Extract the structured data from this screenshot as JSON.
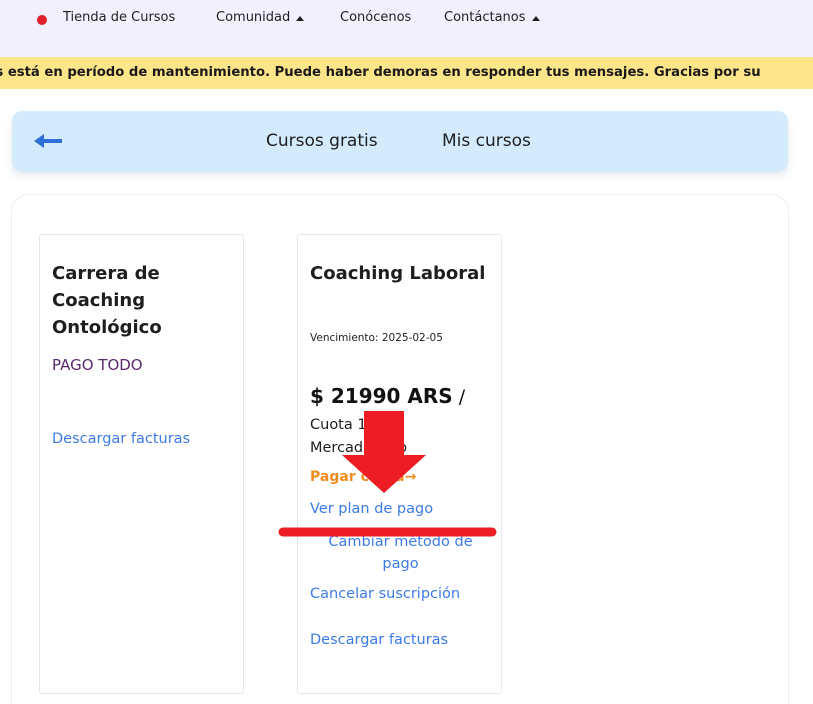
{
  "nav": {
    "store": "Tienda de Cursos",
    "community": "Comunidad",
    "about": "Conócenos",
    "contact": "Contáctanos"
  },
  "banner": {
    "text": "us está en período de mantenimiento. Puede haber demoras en responder tus mensajes. Gracias por su"
  },
  "tabs": {
    "free": "Cursos gratis",
    "mine": "Mis cursos"
  },
  "courses": [
    {
      "title_lines": [
        "Carrera de",
        "Coaching",
        "Ontológico"
      ],
      "status": "PAGO TODO",
      "download": "Descargar facturas"
    },
    {
      "title": "Coaching Laboral",
      "expiry": "Vencimiento: 2025-02-05",
      "price": "$ 21990 ARS",
      "price_suffix": "/",
      "installment_1": "Cuota 1",
      "installment_2": "MercadoPago",
      "pay_installment": "Pagar cuota",
      "pay_arrow": "→",
      "view_plan": "Ver plan de pago",
      "change_method_1": "Cambiar método de",
      "change_method_2": "pago",
      "cancel": "Cancelar suscripción",
      "download": "Descargar facturas"
    }
  ],
  "colors": {
    "nav_bg": "#f3f0fd",
    "banner_bg": "#fde58a",
    "tabbar_bg": "#d4ebfd",
    "link": "#3c7be6",
    "pay": "#f28c1c",
    "paid_status": "#5a2a6e",
    "annotation_red": "#ee1c23"
  },
  "icons": {
    "back": "arrow-left-icon",
    "dot": "red-dot-icon",
    "caret": "caret-up-icon"
  }
}
